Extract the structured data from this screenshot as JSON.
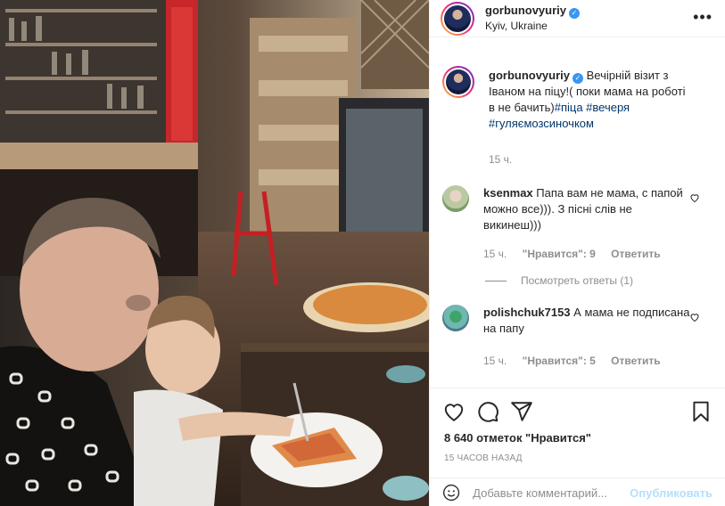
{
  "post": {
    "username": "gorbunovyuriy",
    "location": "Kyiv, Ukraine",
    "more_icon": "more-horizontal-icon",
    "caption": {
      "username": "gorbunovyuriy",
      "text": "Вечірній візит з Іваном на піцу!( поки мама на роботі в не бачить)",
      "hashtags": "#піца #вечеря #гуляємозсиночком",
      "time": "15 ч."
    }
  },
  "comments": [
    {
      "username": "ksenmax",
      "text": "Папа вам не мама, с папой можно все))). З пісні слів не викинеш)))",
      "time": "15 ч.",
      "likes": "\"Нравится\": 9",
      "reply": "Ответить",
      "view_replies": "Посмотреть ответы (1)"
    },
    {
      "username": "polishchuk7153",
      "text": "А мама не подписана на папу",
      "time": "15 ч.",
      "likes": "\"Нравится\": 5",
      "reply": "Ответить"
    }
  ],
  "actions": {
    "likes_count": "8 640 отметок \"Нравится\"",
    "time_ago": "15 ЧАСОВ НАЗАД"
  },
  "add_comment": {
    "placeholder": "Добавьте комментарий...",
    "publish": "Опубликовать"
  },
  "colors": {
    "link": "#00376b",
    "muted": "#8e8e8e",
    "verified": "#3897f0",
    "publish_disabled": "#b2dffc"
  }
}
